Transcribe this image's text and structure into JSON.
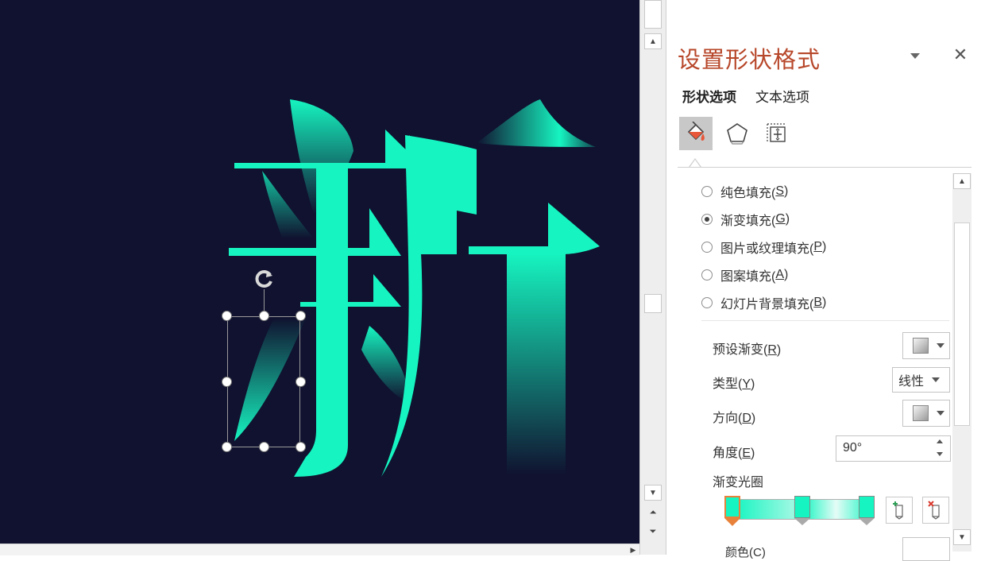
{
  "slide": {
    "glyph": "新",
    "colors": {
      "background": "#10122f",
      "glyph": "#16f5c1",
      "accent": "#b7472a"
    }
  },
  "pane": {
    "title": "设置形状格式",
    "tabs": [
      {
        "label": "形状选项",
        "active": true
      },
      {
        "label": "文本选项",
        "active": false
      }
    ],
    "icons": [
      "fill-line-icon",
      "effects-pentagon-icon",
      "size-properties-icon"
    ],
    "fill_options": [
      {
        "label": "纯色填充(",
        "key": "S",
        "selected": false
      },
      {
        "label": "渐变填充(",
        "key": "G",
        "selected": true
      },
      {
        "label": "图片或纹理填充(",
        "key": "P",
        "selected": false
      },
      {
        "label": "图案填充(",
        "key": "A",
        "selected": false
      },
      {
        "label": "幻灯片背景填充(",
        "key": "B",
        "selected": false
      }
    ],
    "preset_gradient": {
      "label": "预设渐变(",
      "key": "R"
    },
    "type": {
      "label": "类型(",
      "key": "Y",
      "value": "线性"
    },
    "direction": {
      "label": "方向(",
      "key": "D"
    },
    "angle": {
      "label": "角度(",
      "key": "E",
      "value": "90°"
    },
    "gradient_stops": {
      "label": "渐变光圈"
    },
    "color_partial": {
      "label": "颜色(C)"
    }
  }
}
